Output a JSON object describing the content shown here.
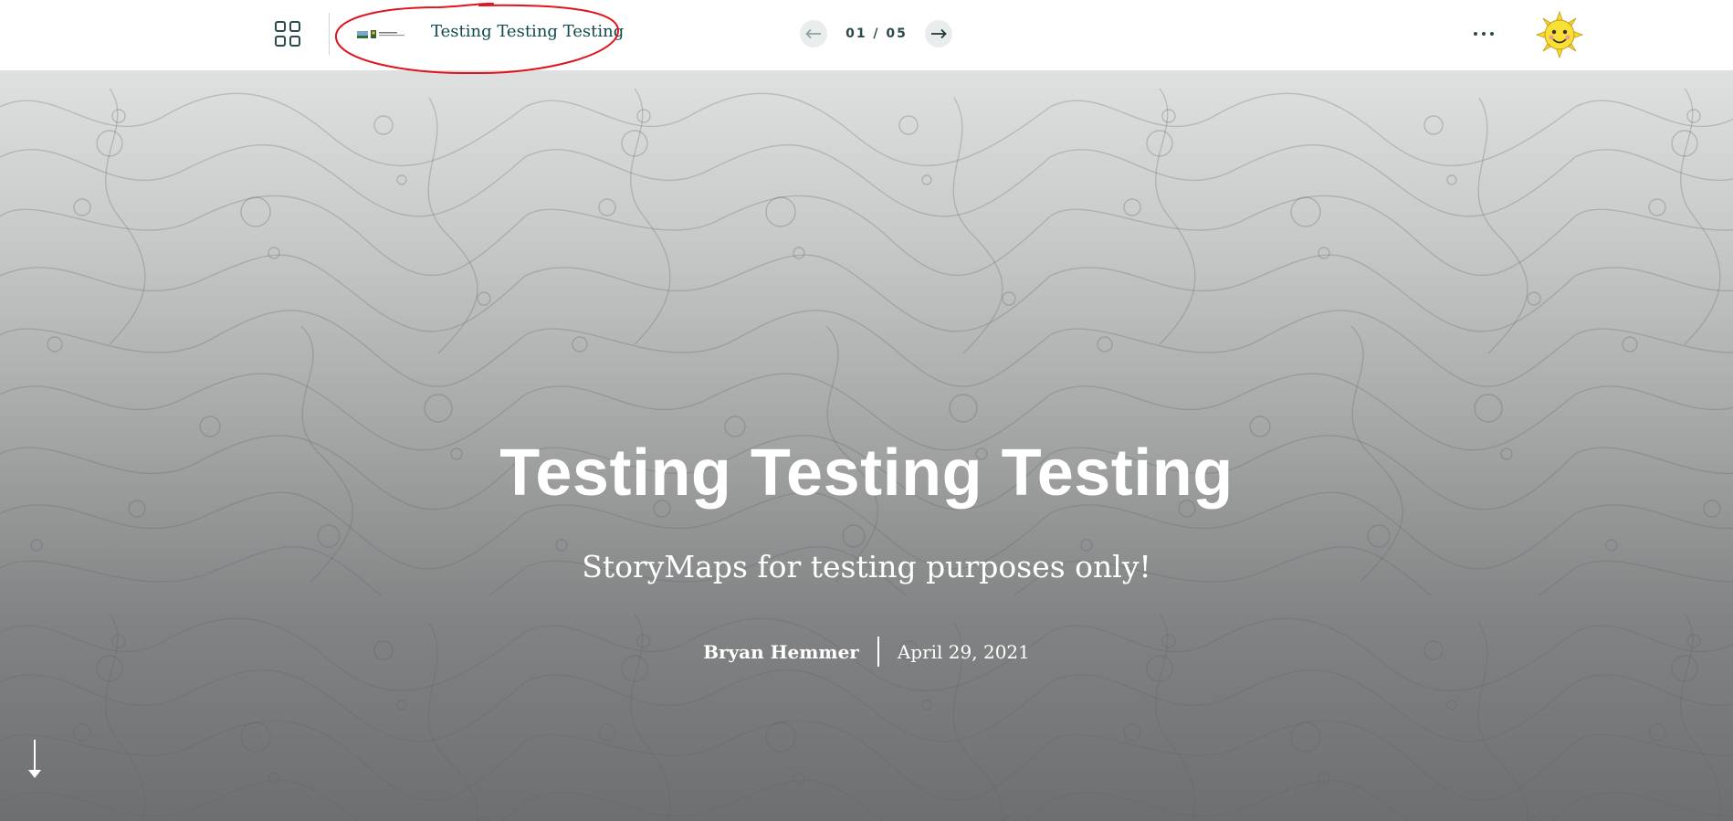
{
  "header": {
    "collection_title": "Testing Testing Testing",
    "counter": "01 / 05",
    "icons": {
      "grid": "grid-icon",
      "logo": "organization-logo",
      "prev": "arrow-left-icon",
      "next": "arrow-right-icon",
      "more": "more-options-icon",
      "avatar": "sun-avatar"
    }
  },
  "cover": {
    "title": "Testing Testing Testing",
    "subtitle": "StoryMaps for testing purposes only!",
    "author": "Bryan Hemmer",
    "date": "April 29, 2021",
    "scroll_icon": "arrow-down-icon"
  },
  "colors": {
    "header_text": "#114a4e",
    "annotation": "#e0141e",
    "cover_top": "#dfe1e1",
    "cover_bottom": "#6e6f70",
    "text_light": "#ffffff"
  }
}
